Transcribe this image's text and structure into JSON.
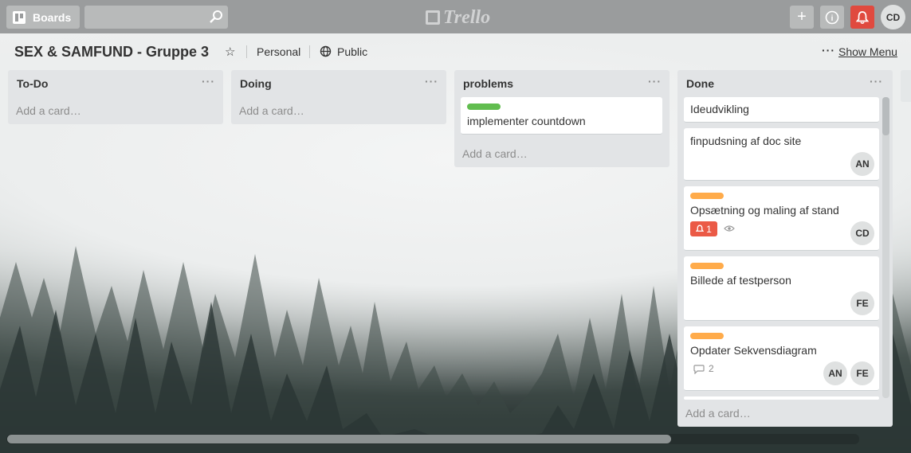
{
  "header": {
    "boards_label": "Boards",
    "search_placeholder": "",
    "logo_text": "Trello",
    "add_label": "+",
    "info_label": "i",
    "user_initials": "CD"
  },
  "board": {
    "title": "SEX & SAMFUND - Gruppe 3",
    "visibility_personal": "Personal",
    "visibility_public": "Public",
    "menu_dots": "···",
    "show_menu": "Show Menu"
  },
  "lists": [
    {
      "title": "To-Do",
      "menu": "···",
      "add_card": "Add a card…",
      "cards": []
    },
    {
      "title": "Doing",
      "menu": "···",
      "add_card": "Add a card…",
      "cards": []
    },
    {
      "title": "problems",
      "menu": "···",
      "add_card": "Add a card…",
      "cards": [
        {
          "label_color": "#61bd4f",
          "text": "implementer countdown"
        }
      ]
    },
    {
      "title": "Done",
      "menu": "···",
      "add_card": "Add a card…",
      "cards": [
        {
          "text": "Ideudvikling"
        },
        {
          "text": "finpudsning af doc site",
          "members": [
            "AN"
          ]
        },
        {
          "label_color": "#ffab4a",
          "text": "Opsætning og maling af stand",
          "notification_count": "1",
          "watching": true,
          "members": [
            "CD"
          ]
        },
        {
          "label_color": "#ffab4a",
          "text": "Billede af testperson",
          "members": [
            "FE"
          ]
        },
        {
          "label_color": "#ffab4a",
          "text": "Opdater Sekvensdiagram",
          "comments": "2",
          "members": [
            "AN",
            "FE"
          ]
        }
      ]
    }
  ],
  "colors": {
    "notification_red": "#e04a3f",
    "label_green": "#61bd4f",
    "label_orange": "#ffab4a"
  }
}
